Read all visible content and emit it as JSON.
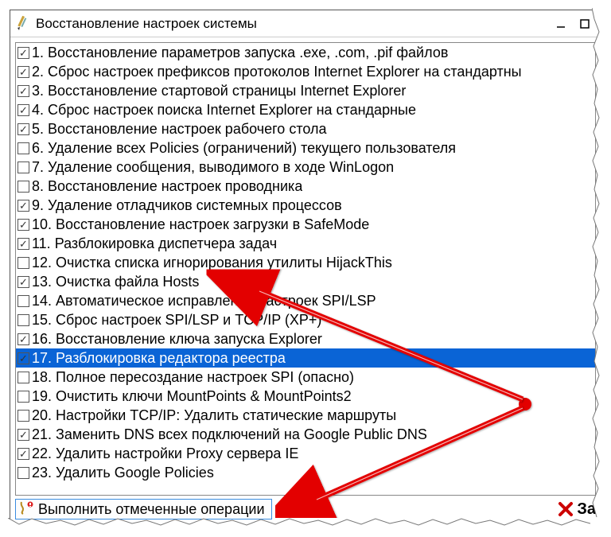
{
  "window": {
    "title": "Восстановление настроек системы"
  },
  "items": [
    {
      "checked": true,
      "label": "1. Восстановление параметров запуска .exe, .com, .pif файлов"
    },
    {
      "checked": true,
      "label": "2. Сброс настроек префиксов протоколов Internet Explorer на стандартны"
    },
    {
      "checked": true,
      "label": "3. Восстановление стартовой страницы Internet Explorer"
    },
    {
      "checked": true,
      "label": "4. Сброс настроек поиска Internet Explorer на стандарные"
    },
    {
      "checked": true,
      "label": "5. Восстановление настроек рабочего стола"
    },
    {
      "checked": false,
      "label": "6. Удаление всех Policies (ограничений) текущего пользователя"
    },
    {
      "checked": false,
      "label": "7. Удаление сообщения, выводимого в ходе WinLogon"
    },
    {
      "checked": false,
      "label": "8. Восстановление настроек проводника"
    },
    {
      "checked": true,
      "label": "9. Удаление отладчиков системных процессов"
    },
    {
      "checked": true,
      "label": "10. Восстановление настроек загрузки в SafeMode"
    },
    {
      "checked": true,
      "label": "11. Разблокировка диспетчера задач"
    },
    {
      "checked": false,
      "label": "12. Очистка списка игнорирования утилиты HijackThis"
    },
    {
      "checked": true,
      "label": "13. Очистка файла Hosts"
    },
    {
      "checked": false,
      "label": "14. Автоматическое исправление настроек SPI/LSP"
    },
    {
      "checked": false,
      "label": "15. Сброс настроек SPI/LSP и TCP/IP (XP+)"
    },
    {
      "checked": true,
      "label": "16. Восстановление ключа запуска Explorer"
    },
    {
      "checked": true,
      "label": "17. Разблокировка редактора реестра",
      "selected": true
    },
    {
      "checked": false,
      "label": "18. Полное пересоздание настроек SPI (опасно)"
    },
    {
      "checked": false,
      "label": "19. Очистить ключи MountPoints & MountPoints2"
    },
    {
      "checked": false,
      "label": "20. Настройки TCP/IP: Удалить статические маршруты"
    },
    {
      "checked": true,
      "label": "21. Заменить DNS всех подключений на Google Public DNS"
    },
    {
      "checked": true,
      "label": "22. Удалить настройки Proxy сервера IE"
    },
    {
      "checked": false,
      "label": "23. Удалить Google Policies"
    }
  ],
  "toolbar": {
    "run_label": "Выполнить отмеченные операции",
    "close_label": "За"
  }
}
